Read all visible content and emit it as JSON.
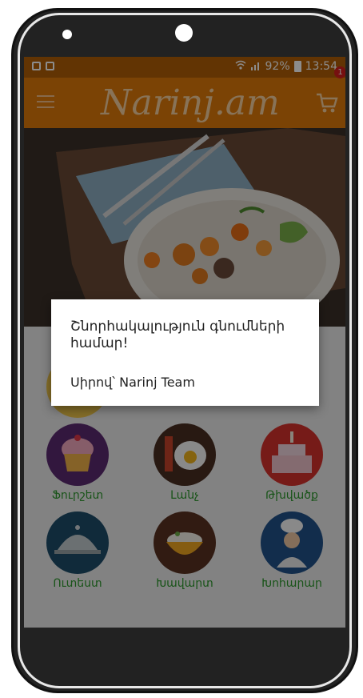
{
  "status_bar": {
    "battery_percent": "92%",
    "time": "13:54"
  },
  "app_bar": {
    "logo_text": "Narinj.am",
    "cart_count": "1"
  },
  "categories": [
    {
      "label": "Ֆուրշետ",
      "icon": "cupcake-icon"
    },
    {
      "label": "Լանչ",
      "icon": "fried-egg-icon"
    },
    {
      "label": "Թխվածք",
      "icon": "birthday-cake-icon"
    },
    {
      "label": "Ուտեստ",
      "icon": "food-cloche-icon"
    },
    {
      "label": "Խավարտ",
      "icon": "rice-bowl-icon"
    },
    {
      "label": "Խոհարար",
      "icon": "chef-icon"
    }
  ],
  "dialog": {
    "message": "Շնորհակալություն գնումների համար!",
    "signature": "Սիրով՝ Narinj Team"
  },
  "colors": {
    "app_bar": "#e17a0a",
    "status_bar": "#b35f06",
    "label_green": "#2f9a2f"
  }
}
